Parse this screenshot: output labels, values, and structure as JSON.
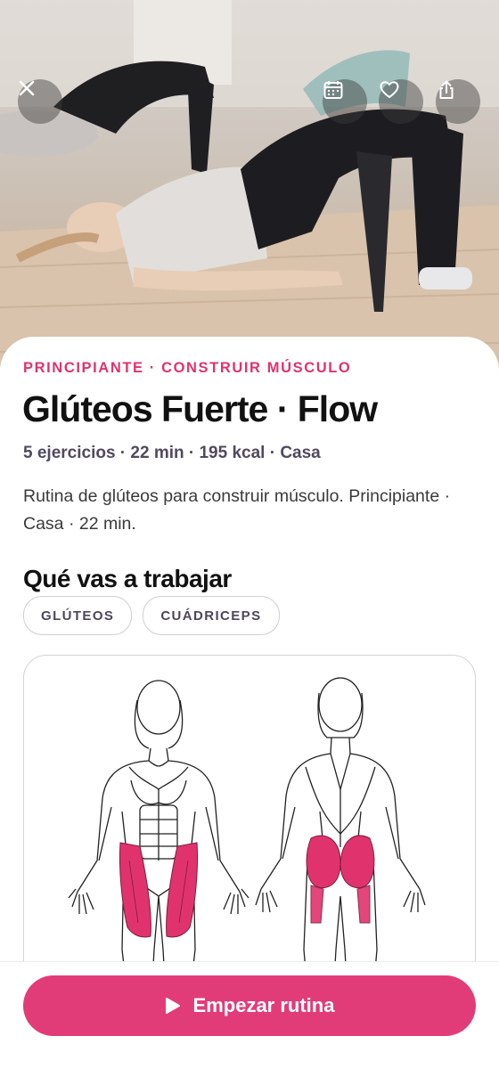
{
  "hero": {
    "close_icon": "close-icon",
    "actions": [
      "calendar-icon",
      "heart-icon",
      "share-icon"
    ]
  },
  "workout": {
    "level_goal": "PRINCIPIANTE · CONSTRUIR MÚSCULO",
    "title": "Glúteos Fuerte · Flow",
    "meta": "5 ejercicios · 22 min · 195 kcal · Casa",
    "description": "Rutina de glúteos para construir músculo. Principiante · Casa · 22 min."
  },
  "muscles": {
    "heading": "Qué vas a trabajar",
    "chips": [
      "GLÚTEOS",
      "CUÁDRICEPS"
    ],
    "highlight_color": "#e0336d"
  },
  "cta": {
    "label": "Empezar rutina",
    "icon": "play-icon",
    "color": "#e23c78"
  }
}
